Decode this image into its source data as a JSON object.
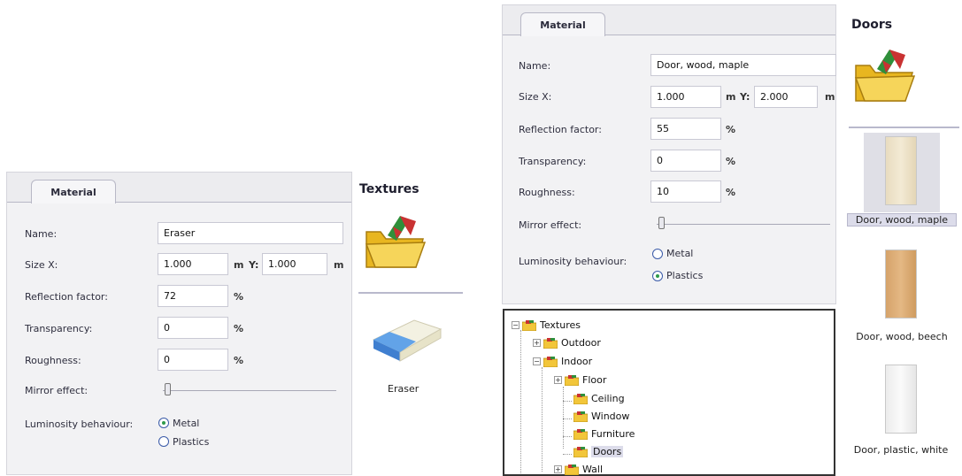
{
  "left_dialog": {
    "tab_label": "Material",
    "name_label": "Name:",
    "name_value": "Eraser",
    "size_label": "Size X:",
    "size_x_value": "1.000",
    "size_x_unit": "m",
    "size_y_label": "Y:",
    "size_y_value": "1.000",
    "size_y_unit": "m",
    "reflection_label": "Reflection factor:",
    "reflection_value": "72",
    "reflection_unit": "%",
    "transparency_label": "Transparency:",
    "transparency_value": "0",
    "transparency_unit": "%",
    "roughness_label": "Roughness:",
    "roughness_value": "0",
    "roughness_unit": "%",
    "mirror_label": "Mirror effect:",
    "mirror_level": 0,
    "luminosity_label": "Luminosity behaviour:",
    "option_metal": "Metal",
    "option_plastics": "Plastics",
    "selected": "Metal"
  },
  "left_sidebar": {
    "title": "Textures",
    "item_caption": "Eraser"
  },
  "right_dialog": {
    "tab_label": "Material",
    "name_label": "Name:",
    "name_value": "Door, wood, maple",
    "size_label": "Size X:",
    "size_x_value": "1.000",
    "size_x_unit": "m",
    "size_y_label": "Y:",
    "size_y_value": "2.000",
    "size_y_unit": "m",
    "reflection_label": "Reflection factor:",
    "reflection_value": "55",
    "reflection_unit": "%",
    "transparency_label": "Transparency:",
    "transparency_value": "0",
    "transparency_unit": "%",
    "roughness_label": "Roughness:",
    "roughness_value": "10",
    "roughness_unit": "%",
    "mirror_label": "Mirror effect:",
    "mirror_level": 0,
    "luminosity_label": "Luminosity behaviour:",
    "option_metal": "Metal",
    "option_plastics": "Plastics",
    "selected": "Plastics"
  },
  "tree": {
    "root": "Textures",
    "outdoor": "Outdoor",
    "indoor": "Indoor",
    "floor": "Floor",
    "ceiling": "Ceiling",
    "window": "Window",
    "furniture": "Furniture",
    "doors": "Doors",
    "wall": "Wall"
  },
  "right_sidebar": {
    "title": "Doors",
    "items": [
      "Door, wood, maple",
      "Door, wood, beech",
      "Door, plastic, white"
    ],
    "selected": "Door, wood, maple"
  },
  "colors": {
    "folder": "#f2c63a",
    "selected_bg": "#dcdcea",
    "radio_dot": "#2e9a4a"
  }
}
